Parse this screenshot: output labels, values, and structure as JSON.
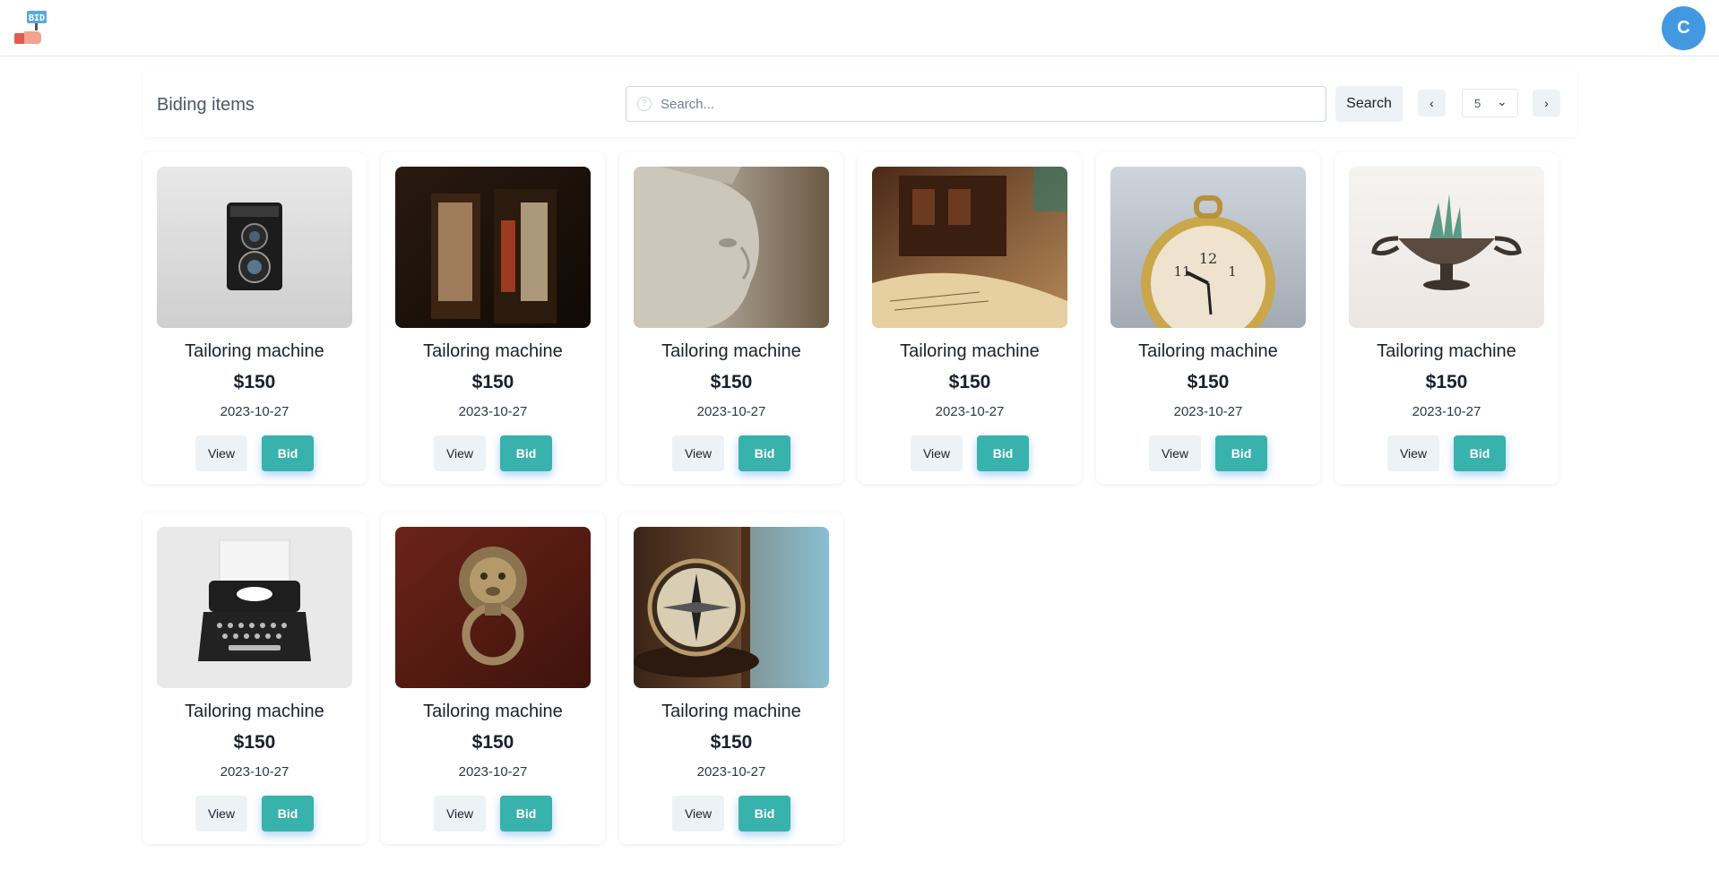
{
  "header": {
    "logo_text": "BID",
    "avatar_initial": "C"
  },
  "toolbar": {
    "title": "Biding items",
    "search_placeholder": "Search...",
    "search_button": "Search",
    "prev_label": "‹",
    "next_label": "›",
    "page_size": "5"
  },
  "items": [
    {
      "title": "Tailoring machine",
      "price": "$150",
      "date": "2023-10-27",
      "view_label": "View",
      "bid_label": "Bid",
      "image": "vintage-camera"
    },
    {
      "title": "Tailoring machine",
      "price": "$150",
      "date": "2023-10-27",
      "view_label": "View",
      "bid_label": "Bid",
      "image": "antique-doors"
    },
    {
      "title": "Tailoring machine",
      "price": "$150",
      "date": "2023-10-27",
      "view_label": "View",
      "bid_label": "Bid",
      "image": "statue-head"
    },
    {
      "title": "Tailoring machine",
      "price": "$150",
      "date": "2023-10-27",
      "view_label": "View",
      "bid_label": "Bid",
      "image": "antique-desk"
    },
    {
      "title": "Tailoring machine",
      "price": "$150",
      "date": "2023-10-27",
      "view_label": "View",
      "bid_label": "Bid",
      "image": "alarm-clock"
    },
    {
      "title": "Tailoring machine",
      "price": "$150",
      "date": "2023-10-27",
      "view_label": "View",
      "bid_label": "Bid",
      "image": "silver-cup-plant"
    },
    {
      "title": "Tailoring machine",
      "price": "$150",
      "date": "2023-10-27",
      "view_label": "View",
      "bid_label": "Bid",
      "image": "typewriter"
    },
    {
      "title": "Tailoring machine",
      "price": "$150",
      "date": "2023-10-27",
      "view_label": "View",
      "bid_label": "Bid",
      "image": "lion-door-knocker"
    },
    {
      "title": "Tailoring machine",
      "price": "$150",
      "date": "2023-10-27",
      "view_label": "View",
      "bid_label": "Bid",
      "image": "compass"
    }
  ],
  "colors": {
    "bid_button": "#38b2ac",
    "avatar": "#4299e1",
    "button_gray": "#edf2f7"
  }
}
